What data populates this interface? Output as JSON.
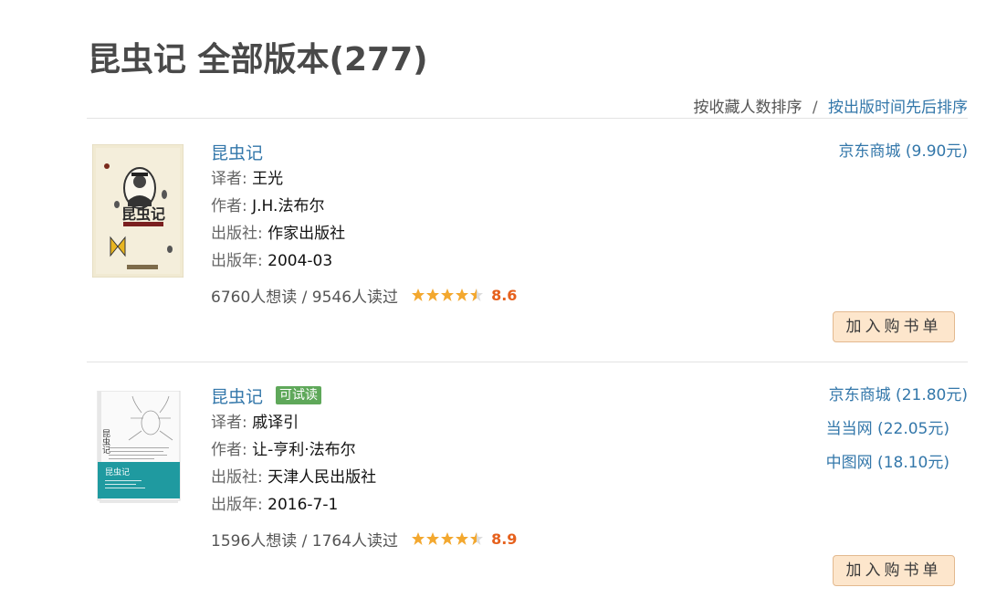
{
  "page": {
    "title": "昆虫记 全部版本(277)"
  },
  "sort": {
    "by_collect": "按收藏人数排序",
    "separator": "/",
    "by_date": "按出版时间先后排序"
  },
  "books": [
    {
      "title": "昆虫记",
      "trial_badge": "",
      "translator_label": "译者: ",
      "translator": "王光",
      "author_label": "作者: ",
      "author": "J.H.法布尔",
      "publisher_label": "出版社: ",
      "publisher": "作家出版社",
      "year_label": "出版年: ",
      "year": "2004-03",
      "stats": "6760人想读 / 9546人读过",
      "rating": "8.6",
      "stores": [
        "京东商城 (9.90元)"
      ],
      "cart_label": "加入购书单",
      "cover_texts": {
        "title": "昆虫记"
      }
    },
    {
      "title": "昆虫记",
      "trial_badge": "可试读",
      "translator_label": "译者: ",
      "translator": "戚译引",
      "author_label": "作者: ",
      "author": "让-亨利·法布尔",
      "publisher_label": "出版社: ",
      "publisher": "天津人民出版社",
      "year_label": "出版年: ",
      "year": "2016-7-1",
      "stats": "1596人想读 / 1764人读过",
      "rating": "8.9",
      "stores": [
        "京东商城 (21.80元)",
        "当当网 (22.05元)",
        "中图网 (18.10元)"
      ],
      "cart_label": "加入购书单",
      "cover_texts": {
        "title": "昆虫记"
      }
    }
  ],
  "colors": {
    "link": "#3377aa",
    "rating": "#e6611d",
    "star": "#f3a82f",
    "trial": "#5fa85a",
    "button_bg": "#fde6cc"
  }
}
